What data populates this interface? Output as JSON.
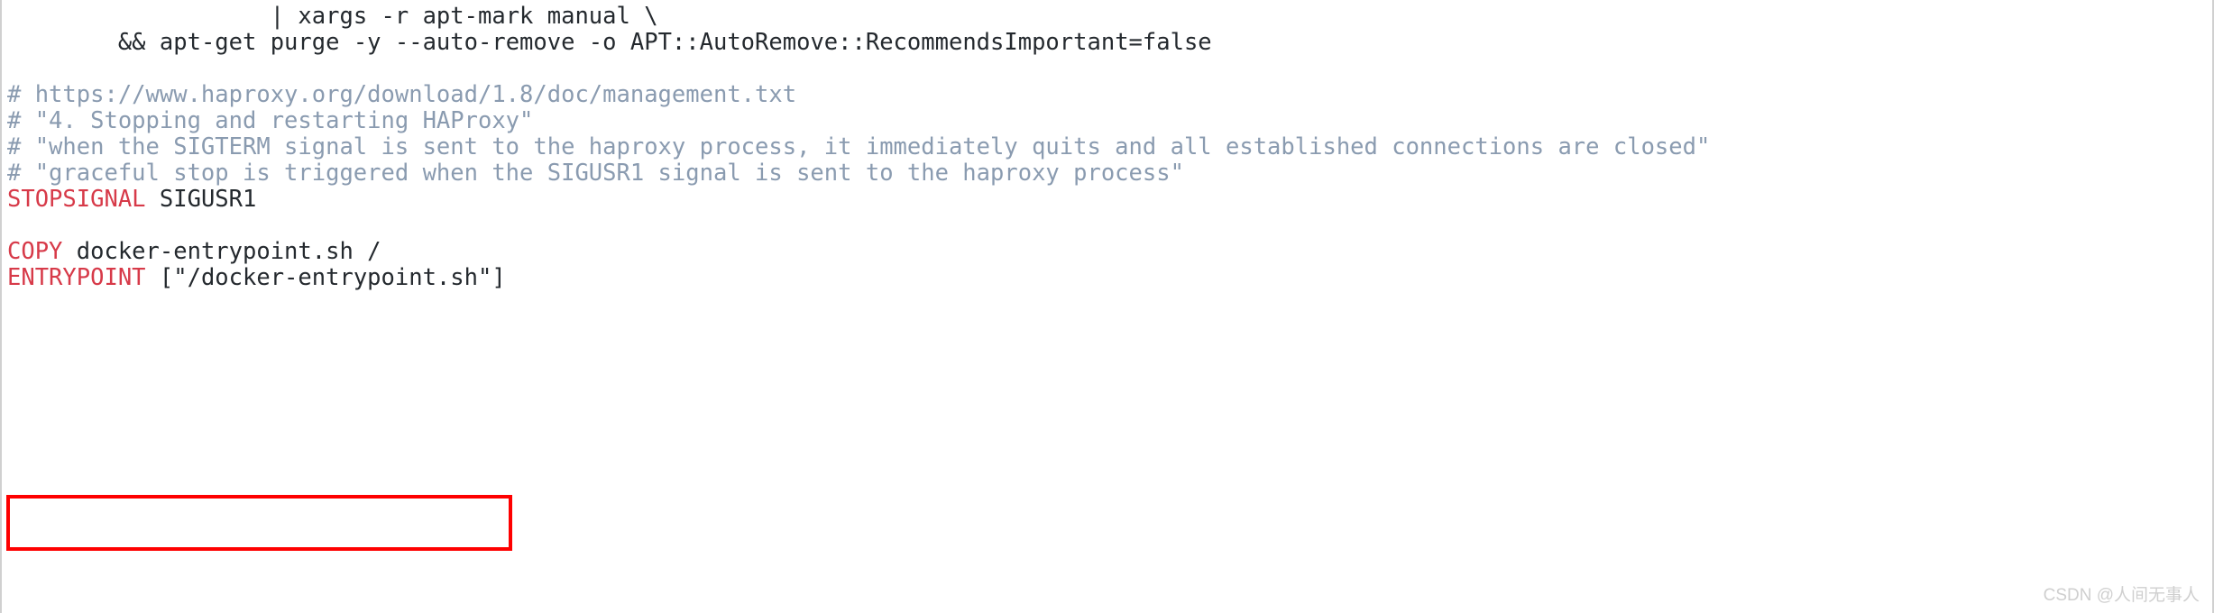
{
  "viewer": {
    "kind": "dockerfile-code-snippet",
    "background_color": "#ffffff",
    "border_color": "#d0d0d0",
    "keyword_color": "#d73a49",
    "comment_color": "#8a9bb0",
    "text_color": "#24292e",
    "highlight_color": "#fe0000"
  },
  "code": {
    "lines": [
      {
        "id": "line-1",
        "type": "continuation",
        "indent": "                   ",
        "text": "| xargs -r apt-mark manual \\"
      },
      {
        "id": "line-2",
        "type": "continuation",
        "indent": "        ",
        "text": "&& apt-get purge -y --auto-remove -o APT::AutoRemove::RecommendsImportant=false"
      },
      {
        "id": "line-3",
        "type": "blank",
        "indent": "",
        "text": ""
      },
      {
        "id": "line-4",
        "type": "comment",
        "indent": "",
        "text": "# https://www.haproxy.org/download/1.8/doc/management.txt"
      },
      {
        "id": "line-5",
        "type": "comment",
        "indent": "",
        "text": "# \"4. Stopping and restarting HAProxy\""
      },
      {
        "id": "line-6",
        "type": "comment",
        "indent": "",
        "text": "# \"when the SIGTERM signal is sent to the haproxy process, it immediately quits and all established connections are closed\""
      },
      {
        "id": "line-7",
        "type": "comment",
        "indent": "",
        "text": "# \"graceful stop is triggered when the SIGUSR1 signal is sent to the haproxy process\""
      },
      {
        "id": "line-8",
        "type": "instruction",
        "indent": "",
        "keyword": "STOPSIGNAL",
        "args": " SIGUSR1"
      },
      {
        "id": "line-9",
        "type": "blank",
        "indent": "",
        "text": ""
      },
      {
        "id": "line-10",
        "type": "instruction",
        "indent": "",
        "keyword": "COPY",
        "args": " docker-entrypoint.sh /"
      },
      {
        "id": "line-11",
        "type": "instruction",
        "indent": "",
        "keyword": "ENTRYPOINT",
        "args": " [\"/docker-entrypoint.sh\"]"
      }
    ]
  },
  "annotation": {
    "highlight_target": "COPY docker-entrypoint.sh /",
    "shape": "rectangle",
    "color": "#fe0000"
  },
  "watermark": {
    "text": "CSDN @人间无事人"
  }
}
